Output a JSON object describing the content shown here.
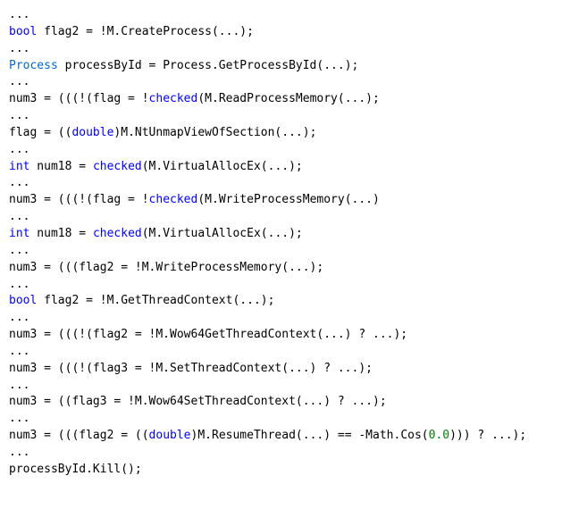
{
  "code": {
    "lines": [
      {
        "type": "ellipsis",
        "text": "..."
      },
      {
        "type": "stmt",
        "tokens": [
          {
            "cls": "kw",
            "t": "bool"
          },
          {
            "cls": "plain",
            "t": " flag2 = !M.CreateProcess(...);"
          }
        ]
      },
      {
        "type": "ellipsis",
        "text": "..."
      },
      {
        "type": "stmt",
        "tokens": [
          {
            "cls": "typ",
            "t": "Process"
          },
          {
            "cls": "plain",
            "t": " processById = Process.GetProcessById(...);"
          }
        ]
      },
      {
        "type": "ellipsis",
        "text": "..."
      },
      {
        "type": "stmt",
        "tokens": [
          {
            "cls": "plain",
            "t": "num3 = (((!(flag = !"
          },
          {
            "cls": "kw",
            "t": "checked"
          },
          {
            "cls": "plain",
            "t": "(M.ReadProcessMemory(...);"
          }
        ]
      },
      {
        "type": "ellipsis",
        "text": "..."
      },
      {
        "type": "stmt",
        "tokens": [
          {
            "cls": "plain",
            "t": "flag = (("
          },
          {
            "cls": "kw",
            "t": "double"
          },
          {
            "cls": "plain",
            "t": ")M.NtUnmapViewOfSection(...);"
          }
        ]
      },
      {
        "type": "ellipsis",
        "text": "..."
      },
      {
        "type": "stmt",
        "tokens": [
          {
            "cls": "kw",
            "t": "int"
          },
          {
            "cls": "plain",
            "t": " num18 = "
          },
          {
            "cls": "kw",
            "t": "checked"
          },
          {
            "cls": "plain",
            "t": "(M.VirtualAllocEx(...);"
          }
        ]
      },
      {
        "type": "ellipsis",
        "text": "..."
      },
      {
        "type": "stmt",
        "tokens": [
          {
            "cls": "plain",
            "t": "num3 = (((!(flag = !"
          },
          {
            "cls": "kw",
            "t": "checked"
          },
          {
            "cls": "plain",
            "t": "(M.WriteProcessMemory(...)"
          }
        ]
      },
      {
        "type": "ellipsis",
        "text": "..."
      },
      {
        "type": "stmt",
        "tokens": [
          {
            "cls": "kw",
            "t": "int"
          },
          {
            "cls": "plain",
            "t": " num18 = "
          },
          {
            "cls": "kw",
            "t": "checked"
          },
          {
            "cls": "plain",
            "t": "(M.VirtualAllocEx(...);"
          }
        ]
      },
      {
        "type": "ellipsis",
        "text": "..."
      },
      {
        "type": "stmt",
        "tokens": [
          {
            "cls": "plain",
            "t": "num3 = (((flag2 = !M.WriteProcessMemory(...);"
          }
        ]
      },
      {
        "type": "ellipsis",
        "text": "..."
      },
      {
        "type": "stmt",
        "tokens": [
          {
            "cls": "kw",
            "t": "bool"
          },
          {
            "cls": "plain",
            "t": " flag2 = !M.GetThreadContext(...);"
          }
        ]
      },
      {
        "type": "ellipsis",
        "text": "..."
      },
      {
        "type": "stmt",
        "tokens": [
          {
            "cls": "plain",
            "t": "num3 = (((!(flag2 = !M.Wow64GetThreadContext(...) ? ...);"
          }
        ]
      },
      {
        "type": "ellipsis",
        "text": "..."
      },
      {
        "type": "stmt",
        "tokens": [
          {
            "cls": "plain",
            "t": "num3 = (((!(flag3 = !M.SetThreadContext(...) ? ...);"
          }
        ]
      },
      {
        "type": "ellipsis",
        "text": "..."
      },
      {
        "type": "stmt",
        "tokens": [
          {
            "cls": "plain",
            "t": "num3 = ((flag3 = !M.Wow64SetThreadContext(...) ? ...);"
          }
        ]
      },
      {
        "type": "ellipsis",
        "text": "..."
      },
      {
        "type": "stmt",
        "tokens": [
          {
            "cls": "plain",
            "t": "num3 = (((flag2 = (("
          },
          {
            "cls": "kw",
            "t": "double"
          },
          {
            "cls": "plain",
            "t": ")M.ResumeThread(...) == -Math.Cos("
          },
          {
            "cls": "num",
            "t": "0.0"
          },
          {
            "cls": "plain",
            "t": "))) ? ...);"
          }
        ]
      },
      {
        "type": "ellipsis",
        "text": "..."
      },
      {
        "type": "stmt",
        "tokens": [
          {
            "cls": "plain",
            "t": "processById.Kill();"
          }
        ]
      }
    ]
  }
}
